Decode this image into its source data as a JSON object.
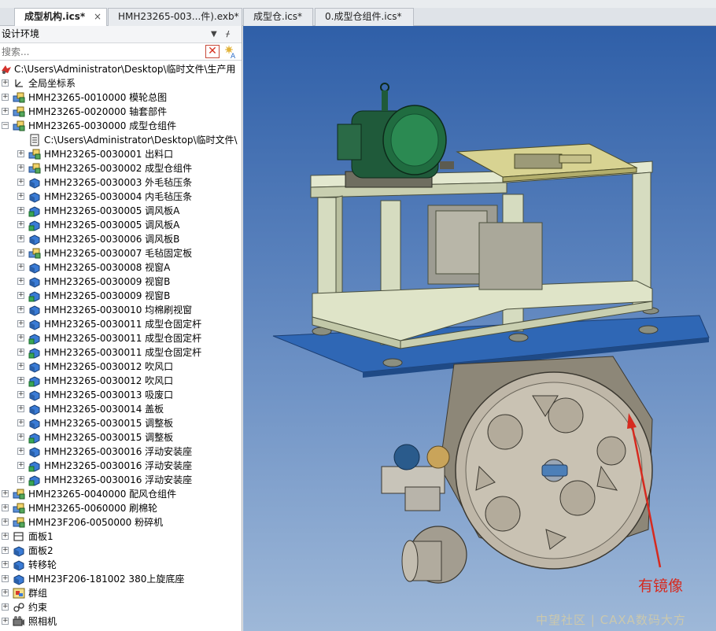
{
  "tabs": [
    {
      "label": "成型机构.ics*",
      "close": "×"
    },
    {
      "label": "HMH23265-003...件).exb*"
    },
    {
      "label": "成型仓.ics*"
    },
    {
      "label": "0.成型仓组件.ics*"
    }
  ],
  "panel": {
    "title": "设计环境",
    "dropdown_glyph": "▼",
    "pin_glyph": "ᚋ",
    "search_placeholder": "搜索...",
    "clear_glyph": "✕"
  },
  "tree": [
    {
      "label": "C:\\Users\\Administrator\\Desktop\\临时文件\\生产用",
      "level": 0,
      "expander": "",
      "icon": "design-root-icon"
    },
    {
      "label": "全局坐标系",
      "level": 0,
      "expander": "+",
      "icon": "coordinate-system-icon"
    },
    {
      "label": "HMH23265-0010000 模轮总图",
      "level": 0,
      "expander": "+",
      "icon": "assembly-icon"
    },
    {
      "label": "HMH23265-0020000 轴套部件",
      "level": 0,
      "expander": "+",
      "icon": "assembly-icon"
    },
    {
      "label": "HMH23265-0030000 成型仓组件",
      "level": 0,
      "expander": "−",
      "icon": "assembly-icon"
    },
    {
      "label": "C:\\Users\\Administrator\\Desktop\\临时文件\\",
      "level": 1,
      "expander": "",
      "icon": "document-icon"
    },
    {
      "label": "HMH23265-0030001 出料口",
      "level": 1,
      "expander": "+",
      "icon": "assembly-icon"
    },
    {
      "label": "HMH23265-0030002 成型仓组件",
      "level": 1,
      "expander": "+",
      "icon": "assembly-icon"
    },
    {
      "label": "HMH23265-0030003 外毛毡压条",
      "level": 1,
      "expander": "+",
      "icon": "part-icon"
    },
    {
      "label": "HMH23265-0030004 内毛毡压条",
      "level": 1,
      "expander": "+",
      "icon": "part-icon"
    },
    {
      "label": "HMH23265-0030005 调风板A",
      "level": 1,
      "expander": "+",
      "icon": "part-linked-icon"
    },
    {
      "label": "HMH23265-0030005 调风板A",
      "level": 1,
      "expander": "+",
      "icon": "part-linked-icon"
    },
    {
      "label": "HMH23265-0030006 调风板B",
      "level": 1,
      "expander": "+",
      "icon": "part-icon"
    },
    {
      "label": "HMH23265-0030007 毛毡固定板",
      "level": 1,
      "expander": "+",
      "icon": "assembly-icon"
    },
    {
      "label": "HMH23265-0030008 视窗A",
      "level": 1,
      "expander": "+",
      "icon": "part-icon"
    },
    {
      "label": "HMH23265-0030009 视窗B",
      "level": 1,
      "expander": "+",
      "icon": "part-icon"
    },
    {
      "label": "HMH23265-0030009 视窗B",
      "level": 1,
      "expander": "+",
      "icon": "part-linked-icon"
    },
    {
      "label": "HMH23265-0030010 均棉刷视窗",
      "level": 1,
      "expander": "+",
      "icon": "part-icon"
    },
    {
      "label": "HMH23265-0030011 成型仓固定杆",
      "level": 1,
      "expander": "+",
      "icon": "part-icon"
    },
    {
      "label": "HMH23265-0030011 成型仓固定杆",
      "level": 1,
      "expander": "+",
      "icon": "part-linked-icon"
    },
    {
      "label": "HMH23265-0030011 成型仓固定杆",
      "level": 1,
      "expander": "+",
      "icon": "part-linked-icon"
    },
    {
      "label": "HMH23265-0030012 吹风口",
      "level": 1,
      "expander": "+",
      "icon": "part-icon"
    },
    {
      "label": "HMH23265-0030012 吹风口",
      "level": 1,
      "expander": "+",
      "icon": "part-linked-icon"
    },
    {
      "label": "HMH23265-0030013 吸废口",
      "level": 1,
      "expander": "+",
      "icon": "part-icon"
    },
    {
      "label": "HMH23265-0030014 盖板",
      "level": 1,
      "expander": "+",
      "icon": "part-icon"
    },
    {
      "label": "HMH23265-0030015 调整板",
      "level": 1,
      "expander": "+",
      "icon": "part-icon"
    },
    {
      "label": "HMH23265-0030015 调整板",
      "level": 1,
      "expander": "+",
      "icon": "part-linked-icon"
    },
    {
      "label": "HMH23265-0030016 浮动安装座",
      "level": 1,
      "expander": "+",
      "icon": "part-icon"
    },
    {
      "label": "HMH23265-0030016 浮动安装座",
      "level": 1,
      "expander": "+",
      "icon": "part-linked-icon"
    },
    {
      "label": "HMH23265-0030016 浮动安装座",
      "level": 1,
      "expander": "+",
      "icon": "part-linked-icon"
    },
    {
      "label": "HMH23265-0040000 配风仓组件",
      "level": 0,
      "expander": "+",
      "icon": "assembly-icon"
    },
    {
      "label": "HMH23265-0060000 刷棉轮",
      "level": 0,
      "expander": "+",
      "icon": "assembly-icon"
    },
    {
      "label": "HMH23F206-0050000 粉碎机",
      "level": 0,
      "expander": "+",
      "icon": "assembly-icon"
    },
    {
      "label": "面板1",
      "level": 0,
      "expander": "+",
      "icon": "panel-icon"
    },
    {
      "label": "面板2",
      "level": 0,
      "expander": "+",
      "icon": "part-icon"
    },
    {
      "label": "转移轮",
      "level": 0,
      "expander": "+",
      "icon": "part-icon"
    },
    {
      "label": "HMH23F206-181002 380上旋底座",
      "level": 0,
      "expander": "+",
      "icon": "part-icon"
    },
    {
      "label": "群组",
      "level": 0,
      "expander": "+",
      "icon": "group-icon"
    },
    {
      "label": "约束",
      "level": 0,
      "expander": "+",
      "icon": "constraint-icon"
    },
    {
      "label": "照相机",
      "level": 0,
      "expander": "+",
      "icon": "camera-icon"
    }
  ],
  "viewport": {
    "annotation_text": "有镜像",
    "watermark_text": "中望社区 | CAXA数码大方",
    "colors": {
      "frame": "#d6dcc0",
      "motor": "#1f5a3a",
      "plate": "#2f67b5",
      "yellow_plate": "#d8d392",
      "wheel": "#bfb7a8",
      "annotation": "#d62a1f"
    }
  }
}
